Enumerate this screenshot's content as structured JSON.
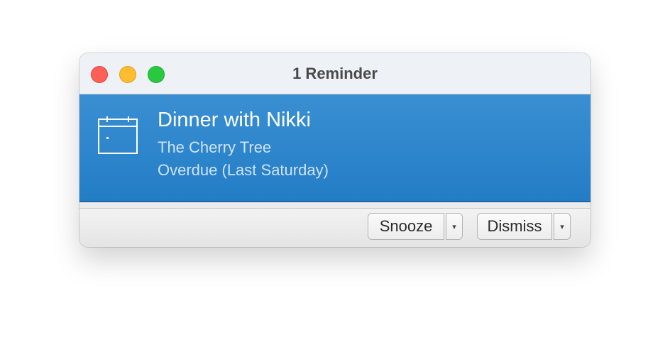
{
  "window": {
    "title": "1 Reminder"
  },
  "reminder": {
    "title": "Dinner with Nikki",
    "location": "The Cherry Tree",
    "due": "Overdue (Last Saturday)",
    "icon": "calendar-icon",
    "highlight_color": "#2e86cf"
  },
  "actions": {
    "snooze_label": "Snooze",
    "dismiss_label": "Dismiss",
    "dropdown_glyph": "▾"
  }
}
